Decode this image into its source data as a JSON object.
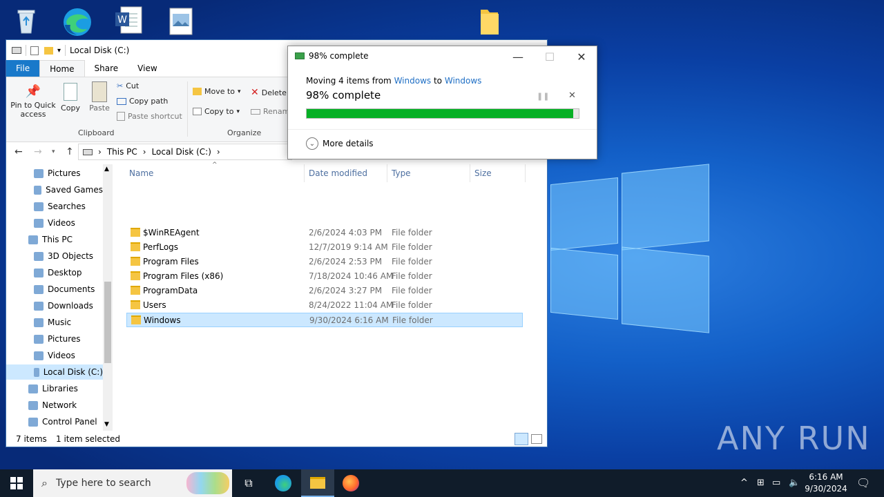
{
  "explorer": {
    "title": "Local Disk (C:)",
    "tabs": [
      "File",
      "Home",
      "Share",
      "View"
    ],
    "ribbon": {
      "pin_label": "Pin to Quick access",
      "copy_label": "Copy",
      "paste_label": "Paste",
      "cut_label": "Cut",
      "copy_path_label": "Copy path",
      "paste_shortcut_label": "Paste shortcut",
      "clipboard_group": "Clipboard",
      "move_to_label": "Move to",
      "copy_to_label": "Copy to",
      "delete_label": "Delete",
      "rename_label": "Renam",
      "organize_group": "Organize"
    },
    "breadcrumb": [
      "This PC",
      "Local Disk (C:)"
    ],
    "nav_items": [
      {
        "label": "Pictures",
        "icon": "pictures-icon"
      },
      {
        "label": "Saved Games",
        "icon": "saved-games-icon"
      },
      {
        "label": "Searches",
        "icon": "search-icon"
      },
      {
        "label": "Videos",
        "icon": "videos-icon"
      },
      {
        "label": "This PC",
        "icon": "computer-icon"
      },
      {
        "label": "3D Objects",
        "icon": "cube-icon"
      },
      {
        "label": "Desktop",
        "icon": "desktop-icon"
      },
      {
        "label": "Documents",
        "icon": "documents-icon"
      },
      {
        "label": "Downloads",
        "icon": "download-icon"
      },
      {
        "label": "Music",
        "icon": "music-icon"
      },
      {
        "label": "Pictures",
        "icon": "pictures-icon"
      },
      {
        "label": "Videos",
        "icon": "videos-icon"
      },
      {
        "label": "Local Disk (C:)",
        "icon": "drive-icon"
      },
      {
        "label": "Libraries",
        "icon": "libraries-icon"
      },
      {
        "label": "Network",
        "icon": "network-icon"
      },
      {
        "label": "Control Panel",
        "icon": "control-panel-icon"
      }
    ],
    "columns": [
      "Name",
      "Date modified",
      "Type",
      "Size"
    ],
    "files": [
      {
        "name": "$WinREAgent",
        "date": "2/6/2024 4:03 PM",
        "type": "File folder"
      },
      {
        "name": "PerfLogs",
        "date": "12/7/2019 9:14 AM",
        "type": "File folder"
      },
      {
        "name": "Program Files",
        "date": "2/6/2024 2:53 PM",
        "type": "File folder"
      },
      {
        "name": "Program Files (x86)",
        "date": "7/18/2024 10:46 AM",
        "type": "File folder"
      },
      {
        "name": "ProgramData",
        "date": "2/6/2024 3:27 PM",
        "type": "File folder"
      },
      {
        "name": "Users",
        "date": "8/24/2022 11:04 AM",
        "type": "File folder"
      },
      {
        "name": "Windows",
        "date": "9/30/2024 6:16 AM",
        "type": "File folder"
      }
    ],
    "status_count": "7 items",
    "status_selected": "1 item selected"
  },
  "dialog": {
    "title": "98% complete",
    "moving_prefix": "Moving 4 items from",
    "from": "Windows",
    "to_word": "to",
    "to": "Windows",
    "percent_text": "98% complete",
    "progress": 0.98,
    "more_details": "More details"
  },
  "taskbar": {
    "search_placeholder": "Type here to search",
    "time": "6:16 AM",
    "date": "9/30/2024"
  },
  "watermark": "ANY RUN",
  "colors": {
    "accent": "#1979ca",
    "progress": "#06b025",
    "selection": "#cce8ff",
    "link": "#1f6fc5"
  }
}
